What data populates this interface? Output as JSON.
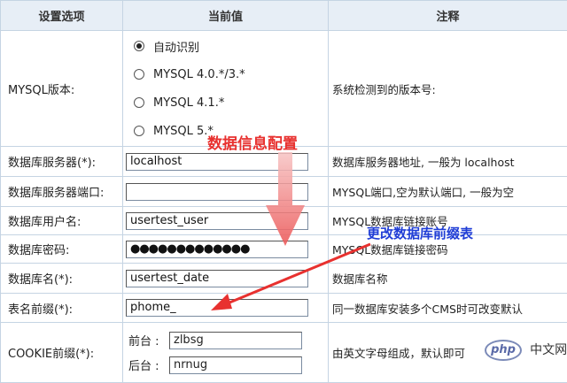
{
  "header": {
    "col1": "设置选项",
    "col2": "当前值",
    "col3": "注释"
  },
  "mysql_version": {
    "label": "MYSQL版本:",
    "options": [
      "自动识别",
      "MYSQL 4.0.*/3.*",
      "MYSQL 4.1.*",
      "MYSQL 5.*"
    ],
    "selected_index": 0,
    "note": "系统检测到的版本号:"
  },
  "rows": [
    {
      "label": "数据库服务器(*):",
      "value": "localhost",
      "note": "数据库服务器地址, 一般为  localhost"
    },
    {
      "label": "数据库服务器端口:",
      "value": "",
      "note": "MYSQL端口,空为默认端口, 一般为空"
    },
    {
      "label": "数据库用户名:",
      "value": "usertest_user",
      "note": "MYSQL数据库链接账号"
    },
    {
      "label": "数据库密码:",
      "value": "●●●●●●●●●●●●●",
      "note": "MYSQL数据库链接密码"
    },
    {
      "label": "数据库名(*):",
      "value": "usertest_date",
      "note": "数据库名称"
    },
    {
      "label": "表名前缀(*):",
      "value": "phome_",
      "note": "同一数据库安装多个CMS时可改变默认"
    }
  ],
  "cookie": {
    "label": "COOKIE前缀(*):",
    "front_label": "前台 :",
    "front_value": "zlbsg",
    "back_label": "后台 :",
    "back_value": "nrnug",
    "note": "由英文字母组成，默认即可"
  },
  "annotations": {
    "db_info": "数据信息配置",
    "prefix_change": "更改数据库前缀表",
    "color": "#e8312f"
  },
  "watermark": {
    "logo": "php",
    "text": "中文网"
  }
}
